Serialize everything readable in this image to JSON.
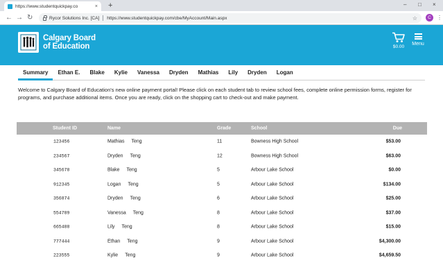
{
  "browser": {
    "tab_title": "https://www.studentquickpay.co",
    "tab_close": "×",
    "new_tab": "+",
    "window_controls": [
      "–",
      "□",
      "×"
    ],
    "nav": [
      "←",
      "→",
      "↻"
    ],
    "cert_label": "Rycor Solutions Inc. [CA]",
    "url": "https://www.studentquickpay.com/cbe/MyAccount/Main.aspx",
    "star": "☆",
    "profile_initial": "C",
    "kebab": "⋮"
  },
  "header": {
    "brand_line1": "Calgary Board",
    "brand_line2": "of Education",
    "cart_total": "$0.00",
    "menu_label": "Menu",
    "bg_color": "#1ba6d6"
  },
  "tabs": [
    "Summary",
    "Ethan E.",
    "Blake",
    "Kylie",
    "Vanessa",
    "Dryden",
    "Mathias",
    "Lily",
    "Dryden",
    "Logan"
  ],
  "welcome_text": "Welcome to Calgary Board of Education's new online payment portal! Please click on each student tab to review school fees, complete online permission forms, register for programs, and purchase additional items. Once you are ready, click on the shopping cart to check-out and make payment.",
  "table": {
    "headers": {
      "id": "Student ID",
      "name": "Name",
      "grade": "Grade",
      "school": "School",
      "due": "Due"
    },
    "rows": [
      {
        "id": "123456",
        "first": "Mathias",
        "last": "Teng",
        "grade": "11",
        "school": "Bowness High School",
        "due": "$53.00"
      },
      {
        "id": "234567",
        "first": "Dryden",
        "last": "Teng",
        "grade": "12",
        "school": "Bowness High School",
        "due": "$63.00"
      },
      {
        "id": "345678",
        "first": "Blake",
        "last": "Teng",
        "grade": "5",
        "school": "Arbour Lake School",
        "due": "$0.00"
      },
      {
        "id": "912345",
        "first": "Logan",
        "last": "Teng",
        "grade": "5",
        "school": "Arbour Lake School",
        "due": "$134.00"
      },
      {
        "id": "356874",
        "first": "Dryden",
        "last": "Teng",
        "grade": "6",
        "school": "Arbour Lake School",
        "due": "$25.00"
      },
      {
        "id": "554789",
        "first": "Vanessa",
        "last": "Teng",
        "grade": "8",
        "school": "Arbour Lake School",
        "due": "$37.00"
      },
      {
        "id": "665488",
        "first": "Lily",
        "last": "Teng",
        "grade": "8",
        "school": "Arbour Lake School",
        "due": "$15.00"
      },
      {
        "id": "777444",
        "first": "Ethan",
        "last": "Teng",
        "grade": "9",
        "school": "Arbour Lake School",
        "due": "$4,300.00"
      },
      {
        "id": "223555",
        "first": "Kylie",
        "last": "Teng",
        "grade": "9",
        "school": "Arbour Lake School",
        "due": "$4,659.50"
      }
    ]
  }
}
